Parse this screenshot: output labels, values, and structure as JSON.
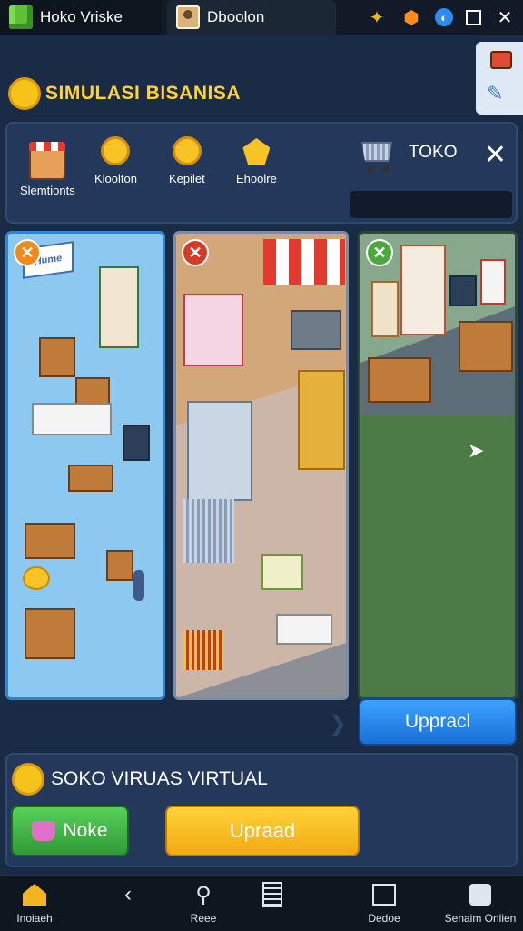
{
  "window": {
    "app_tab_title": "Hoko Vriske",
    "doc_tab_title": "Dboolon",
    "controls": [
      "puzzle-icon",
      "shield-icon",
      "globe-icon",
      "maximize-icon",
      "close-icon"
    ]
  },
  "header": {
    "title": "SIMULASI BISANISA"
  },
  "resources": {
    "items": [
      {
        "icon": "shop-icon",
        "label": "Slemtionts"
      },
      {
        "icon": "coin-icon",
        "label": "Kloolton"
      },
      {
        "icon": "coin-icon",
        "label": "Kepilet"
      },
      {
        "icon": "gem-icon",
        "label": "Ehoolre"
      }
    ],
    "store_label": "TOKO",
    "close_label": "✕"
  },
  "cards": [
    {
      "theme": "warehouse",
      "badge": "✕",
      "sign": "Hume"
    },
    {
      "theme": "shop-street",
      "badge": "✕"
    },
    {
      "theme": "store-interior",
      "badge": "✕"
    }
  ],
  "card_upgrade_label": "Uppracl",
  "virtual_store": {
    "title": "SOKO VIRUAS VIRTUAL",
    "store_button": "Noke",
    "upgrade_button": "Upraad"
  },
  "nav": {
    "items": [
      {
        "icon": "home-icon",
        "label": "Inoiaeh"
      },
      {
        "icon": "back-icon",
        "label": ""
      },
      {
        "icon": "search-icon",
        "label": "Reee"
      },
      {
        "icon": "document-icon",
        "label": ""
      },
      {
        "icon": "frame-icon",
        "label": "Dedoe"
      },
      {
        "icon": "cube-icon",
        "label": "Senaim Onlien"
      }
    ]
  },
  "colors": {
    "background": "#1a2b45",
    "title_gold": "#ffd23a",
    "upgrade_blue": "#1b6fd6",
    "upgrade_yellow": "#f2aa10",
    "store_green": "#2f9a36"
  }
}
